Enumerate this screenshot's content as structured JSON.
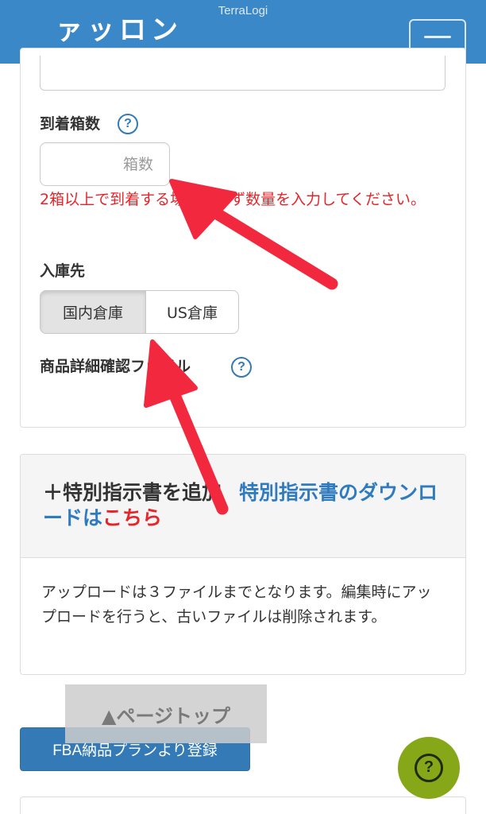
{
  "header": {
    "status_title": "TerraLogi",
    "title_cut": "ァッロン",
    "menu_icon": "hamburger-menu-icon",
    "color": "#3b88c8"
  },
  "form": {
    "boxes_label": "到着箱数",
    "boxes_help_icon": "question-circle-icon",
    "boxes_help_glyph": "?",
    "boxes_placeholder": "箱数",
    "boxes_value": "",
    "boxes_warning": "2箱以上で到着する場合、必ず数量を入力してください。",
    "destination_label": "入庫先",
    "destination_options": [
      "国内倉庫",
      "US倉庫"
    ],
    "destination_selected": "国内倉庫",
    "detail_file_label": "商品詳細確認ファイル",
    "detail_help_icon": "question-circle-icon",
    "detail_help_glyph": "?"
  },
  "instructions": {
    "add_label": "＋特別指示書を追加",
    "download_label": "特別指示書のダウンロードは",
    "download_link": "こちら",
    "note": "アップロードは３ファイルまでとなります。編集時にアップロードを行うと、古いファイルは削除されます。"
  },
  "footer": {
    "page_top_label": "▲ページトップ",
    "fba_button_label": "FBA納品プランより登録",
    "help_fab_icon": "question-circle-icon",
    "help_fab_glyph": "?"
  },
  "colors": {
    "primary": "#337ab7",
    "warning_text": "#e5252a",
    "link_red": "#e5252a",
    "help_fab": "#86a818",
    "annotation_arrow": "#f2283f"
  }
}
